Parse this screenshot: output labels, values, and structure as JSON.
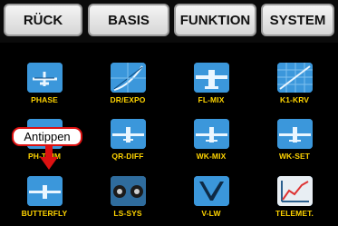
{
  "tabs": [
    {
      "label": "RÜCK"
    },
    {
      "label": "BASIS"
    },
    {
      "label": "FUNKTION"
    },
    {
      "label": "SYSTEM"
    }
  ],
  "menu": [
    {
      "label": "PHASE",
      "icon": "phase-icon"
    },
    {
      "label": "DR/EXPO",
      "icon": "dr-expo-icon"
    },
    {
      "label": "FL-MIX",
      "icon": "fl-mix-icon"
    },
    {
      "label": "K1-KRV",
      "icon": "k1-curve-icon"
    },
    {
      "label": "PH-TRIM",
      "icon": "phase-trim-icon"
    },
    {
      "label": "QR-DIFF",
      "icon": "aileron-diff-icon"
    },
    {
      "label": "WK-MIX",
      "icon": "flap-mix-icon"
    },
    {
      "label": "WK-SET",
      "icon": "flap-set-icon"
    },
    {
      "label": "BUTTERFLY",
      "icon": "butterfly-icon"
    },
    {
      "label": "LS-SYS",
      "icon": "ls-sys-icon"
    },
    {
      "label": "V-LW",
      "icon": "v-tail-icon"
    },
    {
      "label": "TELEMET.",
      "icon": "telemetry-icon"
    }
  ],
  "callout": {
    "text": "Antippen"
  },
  "colors": {
    "tab_text": "#111111",
    "label": "#ffd400",
    "callout_border": "#dd1111",
    "background": "#000000"
  }
}
